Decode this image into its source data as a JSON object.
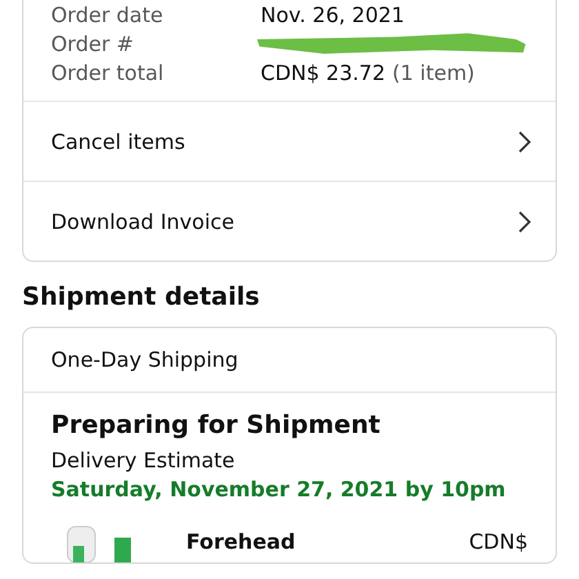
{
  "order_info": [
    {
      "label": "Order date",
      "value": "Nov. 26, 2021"
    },
    {
      "label": "Order #",
      "redacted": true
    },
    {
      "label": "Order total",
      "value": "CDN$ 23.72",
      "note": "(1 item)"
    }
  ],
  "actions": [
    {
      "label": "Cancel items"
    },
    {
      "label": "Download Invoice"
    }
  ],
  "shipment": {
    "heading": "Shipment details",
    "method": "One-Day Shipping",
    "status": "Preparing for Shipment",
    "estimate_label": "Delivery Estimate",
    "estimate": "Saturday, November 27, 2021 by 10pm",
    "items": [
      {
        "name": "Forehead",
        "price": "CDN$"
      }
    ]
  }
}
